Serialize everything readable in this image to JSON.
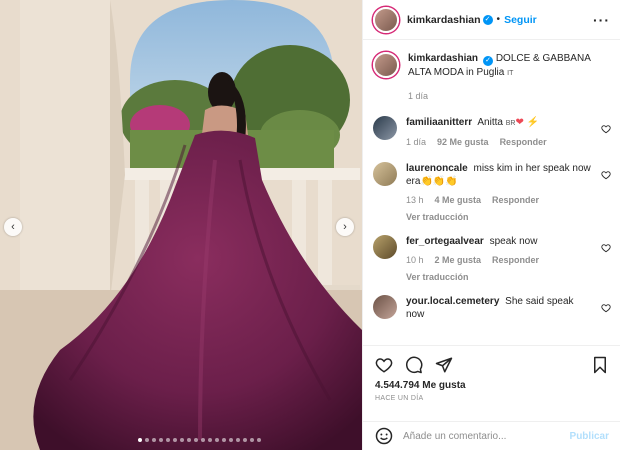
{
  "post": {
    "author": "kimkardashian",
    "follow_label": "Seguir",
    "more_label": "···",
    "caption": "DOLCE & GABBANA ALTA MODA in Puglia",
    "caption_lang_tag": "IT",
    "caption_time": "1 día"
  },
  "media": {
    "prev_icon": "chevron-left-icon",
    "next_icon": "chevron-right-icon",
    "total_slides": 18,
    "active_slide": 0,
    "prev_glyph": "‹",
    "next_glyph": "›"
  },
  "comments": [
    {
      "user": "familiaanitterr",
      "text": "Anitta",
      "lang_tag": "BR",
      "emoji": "❤ ⚡",
      "time": "1 día",
      "likes": "92 Me gusta",
      "reply": "Responder",
      "translate": ""
    },
    {
      "user": "laurenoncale",
      "text": "miss kim in her speak now era👏👏👏",
      "lang_tag": "",
      "emoji": "",
      "time": "13 h",
      "likes": "4 Me gusta",
      "reply": "Responder",
      "translate": "Ver traducción"
    },
    {
      "user": "fer_ortegaalvear",
      "text": "speak now",
      "lang_tag": "",
      "emoji": "",
      "time": "10 h",
      "likes": "2 Me gusta",
      "reply": "Responder",
      "translate": "Ver traducción"
    },
    {
      "user": "your.local.cemetery",
      "text": "She said speak now",
      "lang_tag": "",
      "emoji": "",
      "time": "",
      "likes": "",
      "reply": "",
      "translate": ""
    }
  ],
  "actions": {
    "like_count": "4.544.794 Me gusta",
    "posted_ago": "HACE UN DÍA"
  },
  "composer": {
    "placeholder": "Añade un comentario...",
    "publish_label": "Publicar"
  },
  "colors": {
    "accent": "#0095f6",
    "dress": "#6b1f4a",
    "heart_red": "#ed4956"
  }
}
